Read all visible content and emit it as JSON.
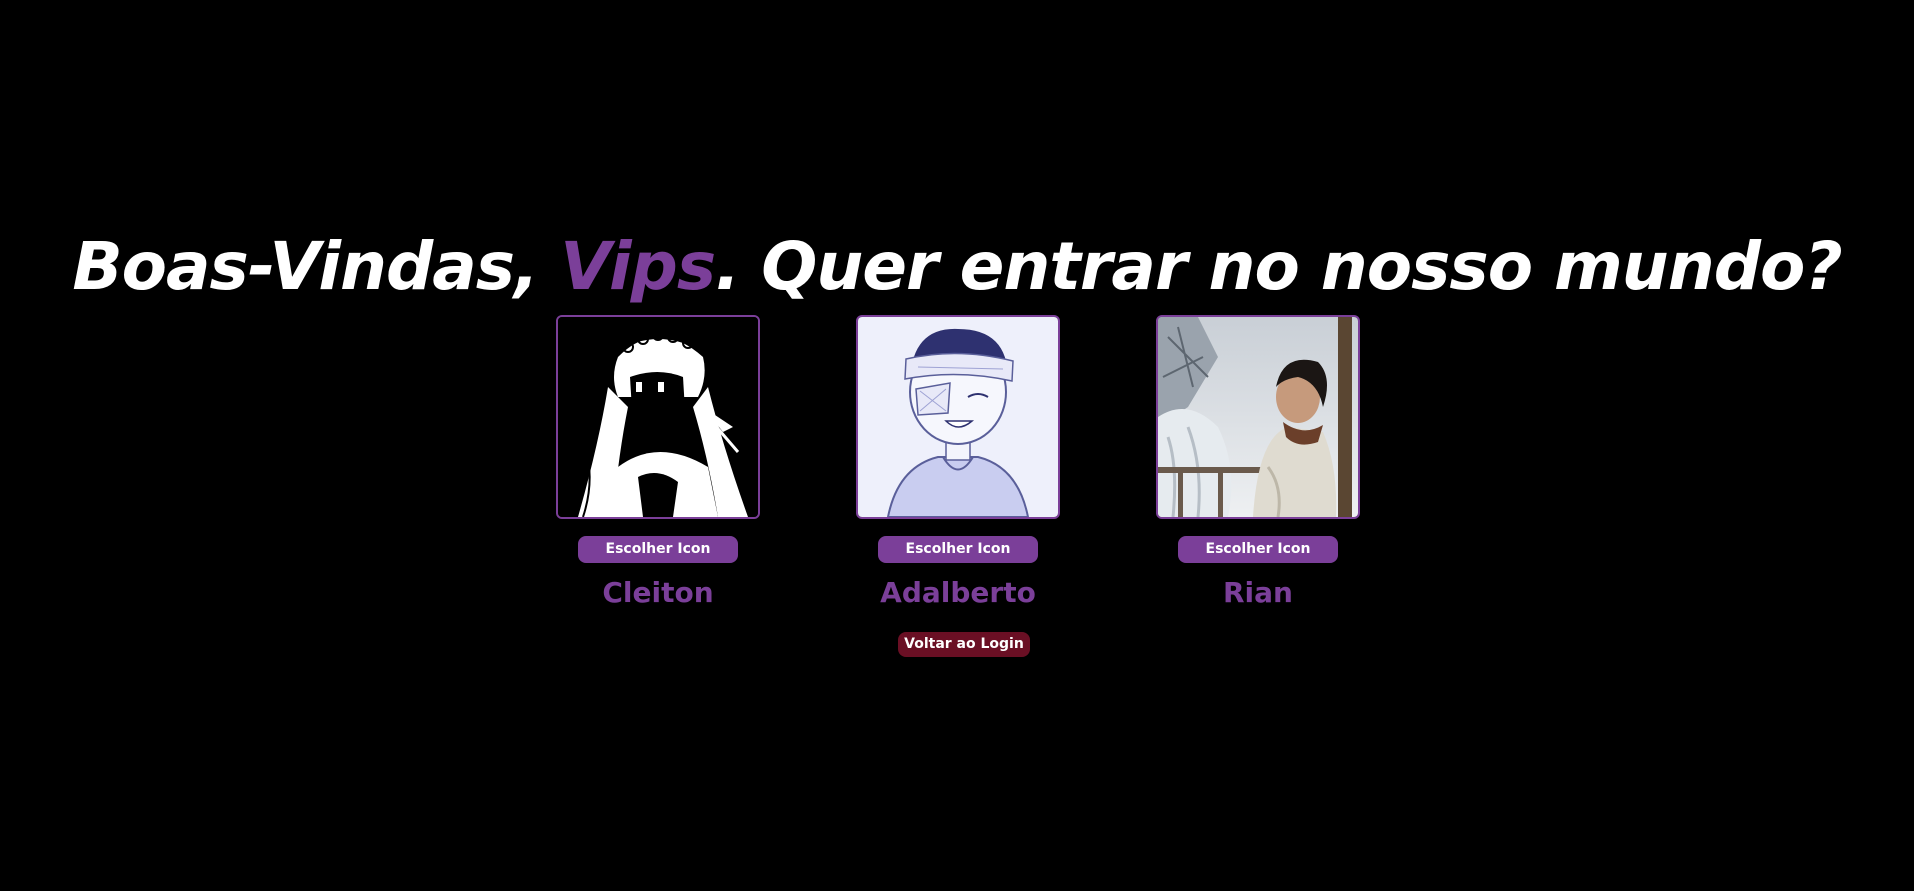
{
  "header": {
    "greeting": "Boas-Vindas, ",
    "username": "Vips",
    "question": ". Quer entrar no nosso mundo?"
  },
  "profiles": [
    {
      "name": "Cleiton",
      "button_label": "Escolher Icon",
      "avatar": "anime-girl-sketch-avatar"
    },
    {
      "name": "Adalberto",
      "button_label": "Escolher Icon",
      "avatar": "bandaged-boy-sketch-avatar"
    },
    {
      "name": "Rian",
      "button_label": "Escolher Icon",
      "avatar": "winter-photo-avatar"
    }
  ],
  "back_button": {
    "label": "Voltar ao Login"
  },
  "colors": {
    "background": "#000000",
    "accent": "#7b3f99",
    "back_button": "#6a0f24",
    "text": "#ffffff"
  }
}
